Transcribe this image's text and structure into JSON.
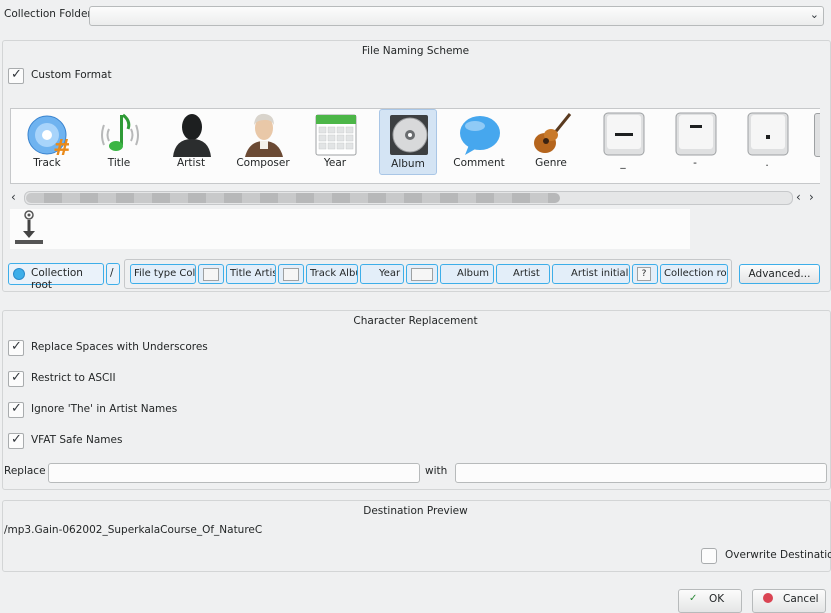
{
  "collection_folder": {
    "label": "Collection Folder:",
    "value": ""
  },
  "naming_scheme": {
    "title": "File Naming Scheme",
    "custom_format_label": "Custom Format",
    "custom_format_checked": true,
    "tokens": [
      {
        "label": "Track",
        "icon": "disc-track-icon"
      },
      {
        "label": "Title",
        "icon": "music-note-icon"
      },
      {
        "label": "Artist",
        "icon": "artist-silhouette-icon"
      },
      {
        "label": "Composer",
        "icon": "composer-portrait-icon"
      },
      {
        "label": "Year",
        "icon": "calendar-icon"
      },
      {
        "label": "Album",
        "icon": "cd-icon"
      },
      {
        "label": "Comment",
        "icon": "speech-bubble-icon"
      },
      {
        "label": "Genre",
        "icon": "guitar-icon"
      },
      {
        "label": "_",
        "icon": "underscore-key-icon"
      },
      {
        "label": "-",
        "icon": "dash-key-icon"
      },
      {
        "label": ".",
        "icon": "dot-key-icon"
      }
    ],
    "selected_token": "Album",
    "collection_root_label": "Collection root",
    "slash_label": "/",
    "format_pills": [
      {
        "text": "File type  Collection root"
      },
      {
        "text": "Title Artist"
      },
      {
        "text": "Track Album"
      },
      {
        "text": "Year"
      },
      {
        "text": "Album"
      },
      {
        "text": "Artist"
      },
      {
        "text": "Artist initial Title"
      },
      {
        "text": "Collection root File type"
      }
    ],
    "advanced_label": "Advanced..."
  },
  "char_replacement": {
    "title": "Character Replacement",
    "options": [
      {
        "label": "Replace Spaces with Underscores",
        "checked": true
      },
      {
        "label": "Restrict to ASCII",
        "checked": true
      },
      {
        "label": "Ignore 'The' in Artist Names",
        "checked": true
      },
      {
        "label": "VFAT Safe Names",
        "checked": true
      }
    ],
    "replace_label": "Replace",
    "replace_value": "",
    "with_label": "with",
    "with_value": ""
  },
  "destination": {
    "title": "Destination Preview",
    "path": "/mp3.Gain-062002_SuperkalaCourse_Of_NatureC",
    "overwrite_label": "Overwrite Destination",
    "overwrite_checked": false
  },
  "footer": {
    "ok_label": "OK",
    "cancel_label": "Cancel"
  },
  "colors": {
    "accent": "#3daee9",
    "background": "#eff0f1",
    "text": "#232627"
  }
}
